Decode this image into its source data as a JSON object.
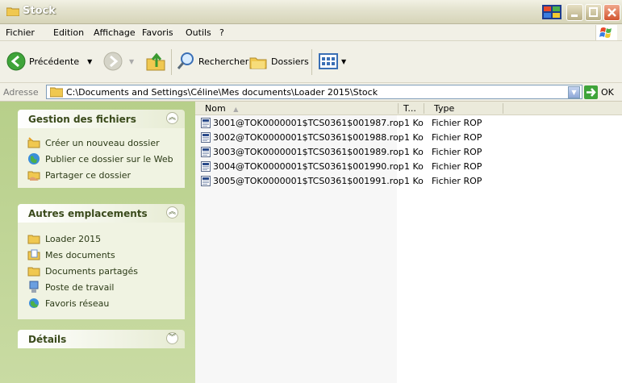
{
  "window": {
    "title": "Stock"
  },
  "menu": [
    "Fichier",
    "Edition",
    "Affichage",
    "Favoris",
    "Outils",
    "?"
  ],
  "toolbar": {
    "back_label": "Précédente",
    "search_label": "Rechercher",
    "folders_label": "Dossiers"
  },
  "address": {
    "label": "Adresse",
    "path": "C:\\Documents and Settings\\Céline\\Mes documents\\Loader 2015\\Stock",
    "go_label": "OK"
  },
  "tasks_panel": {
    "title": "Gestion des fichiers",
    "items": [
      "Créer un nouveau dossier",
      "Publier ce dossier sur le Web",
      "Partager ce dossier"
    ]
  },
  "places_panel": {
    "title": "Autres emplacements",
    "items": [
      "Loader 2015",
      "Mes documents",
      "Documents partagés",
      "Poste de travail",
      "Favoris réseau"
    ]
  },
  "details_panel": {
    "title": "Détails"
  },
  "columns": {
    "name": "Nom",
    "size": "T...",
    "type": "Type"
  },
  "files": [
    {
      "name": "3001@TOK0000001$TCS0361$001987.rop",
      "size": "1 Ko",
      "type": "Fichier ROP"
    },
    {
      "name": "3002@TOK0000001$TCS0361$001988.rop",
      "size": "1 Ko",
      "type": "Fichier ROP"
    },
    {
      "name": "3003@TOK0000001$TCS0361$001989.rop",
      "size": "1 Ko",
      "type": "Fichier ROP"
    },
    {
      "name": "3004@TOK0000001$TCS0361$001990.rop",
      "size": "1 Ko",
      "type": "Fichier ROP"
    },
    {
      "name": "3005@TOK0000001$TCS0361$001991.rop",
      "size": "1 Ko",
      "type": "Fichier ROP"
    }
  ],
  "colors": {
    "title_text": "#ffffff",
    "panel_bg": "#f0f3e2",
    "pane_bg": "#c9dba3"
  }
}
